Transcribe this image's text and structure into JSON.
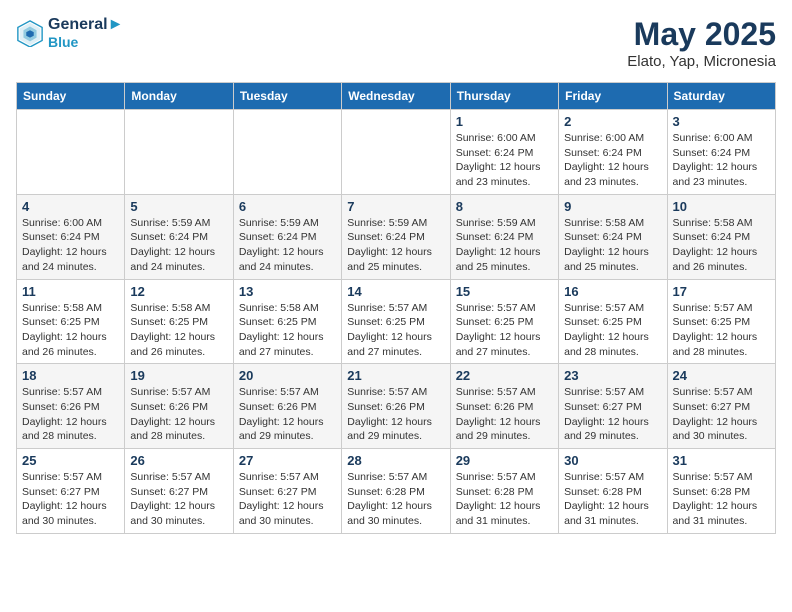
{
  "header": {
    "logo_line1": "General",
    "logo_line2": "Blue",
    "title": "May 2025",
    "subtitle": "Elato, Yap, Micronesia"
  },
  "days_of_week": [
    "Sunday",
    "Monday",
    "Tuesday",
    "Wednesday",
    "Thursday",
    "Friday",
    "Saturday"
  ],
  "weeks": [
    [
      {
        "day": "",
        "info": ""
      },
      {
        "day": "",
        "info": ""
      },
      {
        "day": "",
        "info": ""
      },
      {
        "day": "",
        "info": ""
      },
      {
        "day": "1",
        "info": "Sunrise: 6:00 AM\nSunset: 6:24 PM\nDaylight: 12 hours\nand 23 minutes."
      },
      {
        "day": "2",
        "info": "Sunrise: 6:00 AM\nSunset: 6:24 PM\nDaylight: 12 hours\nand 23 minutes."
      },
      {
        "day": "3",
        "info": "Sunrise: 6:00 AM\nSunset: 6:24 PM\nDaylight: 12 hours\nand 23 minutes."
      }
    ],
    [
      {
        "day": "4",
        "info": "Sunrise: 6:00 AM\nSunset: 6:24 PM\nDaylight: 12 hours\nand 24 minutes."
      },
      {
        "day": "5",
        "info": "Sunrise: 5:59 AM\nSunset: 6:24 PM\nDaylight: 12 hours\nand 24 minutes."
      },
      {
        "day": "6",
        "info": "Sunrise: 5:59 AM\nSunset: 6:24 PM\nDaylight: 12 hours\nand 24 minutes."
      },
      {
        "day": "7",
        "info": "Sunrise: 5:59 AM\nSunset: 6:24 PM\nDaylight: 12 hours\nand 25 minutes."
      },
      {
        "day": "8",
        "info": "Sunrise: 5:59 AM\nSunset: 6:24 PM\nDaylight: 12 hours\nand 25 minutes."
      },
      {
        "day": "9",
        "info": "Sunrise: 5:58 AM\nSunset: 6:24 PM\nDaylight: 12 hours\nand 25 minutes."
      },
      {
        "day": "10",
        "info": "Sunrise: 5:58 AM\nSunset: 6:24 PM\nDaylight: 12 hours\nand 26 minutes."
      }
    ],
    [
      {
        "day": "11",
        "info": "Sunrise: 5:58 AM\nSunset: 6:25 PM\nDaylight: 12 hours\nand 26 minutes."
      },
      {
        "day": "12",
        "info": "Sunrise: 5:58 AM\nSunset: 6:25 PM\nDaylight: 12 hours\nand 26 minutes."
      },
      {
        "day": "13",
        "info": "Sunrise: 5:58 AM\nSunset: 6:25 PM\nDaylight: 12 hours\nand 27 minutes."
      },
      {
        "day": "14",
        "info": "Sunrise: 5:57 AM\nSunset: 6:25 PM\nDaylight: 12 hours\nand 27 minutes."
      },
      {
        "day": "15",
        "info": "Sunrise: 5:57 AM\nSunset: 6:25 PM\nDaylight: 12 hours\nand 27 minutes."
      },
      {
        "day": "16",
        "info": "Sunrise: 5:57 AM\nSunset: 6:25 PM\nDaylight: 12 hours\nand 28 minutes."
      },
      {
        "day": "17",
        "info": "Sunrise: 5:57 AM\nSunset: 6:25 PM\nDaylight: 12 hours\nand 28 minutes."
      }
    ],
    [
      {
        "day": "18",
        "info": "Sunrise: 5:57 AM\nSunset: 6:26 PM\nDaylight: 12 hours\nand 28 minutes."
      },
      {
        "day": "19",
        "info": "Sunrise: 5:57 AM\nSunset: 6:26 PM\nDaylight: 12 hours\nand 28 minutes."
      },
      {
        "day": "20",
        "info": "Sunrise: 5:57 AM\nSunset: 6:26 PM\nDaylight: 12 hours\nand 29 minutes."
      },
      {
        "day": "21",
        "info": "Sunrise: 5:57 AM\nSunset: 6:26 PM\nDaylight: 12 hours\nand 29 minutes."
      },
      {
        "day": "22",
        "info": "Sunrise: 5:57 AM\nSunset: 6:26 PM\nDaylight: 12 hours\nand 29 minutes."
      },
      {
        "day": "23",
        "info": "Sunrise: 5:57 AM\nSunset: 6:27 PM\nDaylight: 12 hours\nand 29 minutes."
      },
      {
        "day": "24",
        "info": "Sunrise: 5:57 AM\nSunset: 6:27 PM\nDaylight: 12 hours\nand 30 minutes."
      }
    ],
    [
      {
        "day": "25",
        "info": "Sunrise: 5:57 AM\nSunset: 6:27 PM\nDaylight: 12 hours\nand 30 minutes."
      },
      {
        "day": "26",
        "info": "Sunrise: 5:57 AM\nSunset: 6:27 PM\nDaylight: 12 hours\nand 30 minutes."
      },
      {
        "day": "27",
        "info": "Sunrise: 5:57 AM\nSunset: 6:27 PM\nDaylight: 12 hours\nand 30 minutes."
      },
      {
        "day": "28",
        "info": "Sunrise: 5:57 AM\nSunset: 6:28 PM\nDaylight: 12 hours\nand 30 minutes."
      },
      {
        "day": "29",
        "info": "Sunrise: 5:57 AM\nSunset: 6:28 PM\nDaylight: 12 hours\nand 31 minutes."
      },
      {
        "day": "30",
        "info": "Sunrise: 5:57 AM\nSunset: 6:28 PM\nDaylight: 12 hours\nand 31 minutes."
      },
      {
        "day": "31",
        "info": "Sunrise: 5:57 AM\nSunset: 6:28 PM\nDaylight: 12 hours\nand 31 minutes."
      }
    ]
  ]
}
